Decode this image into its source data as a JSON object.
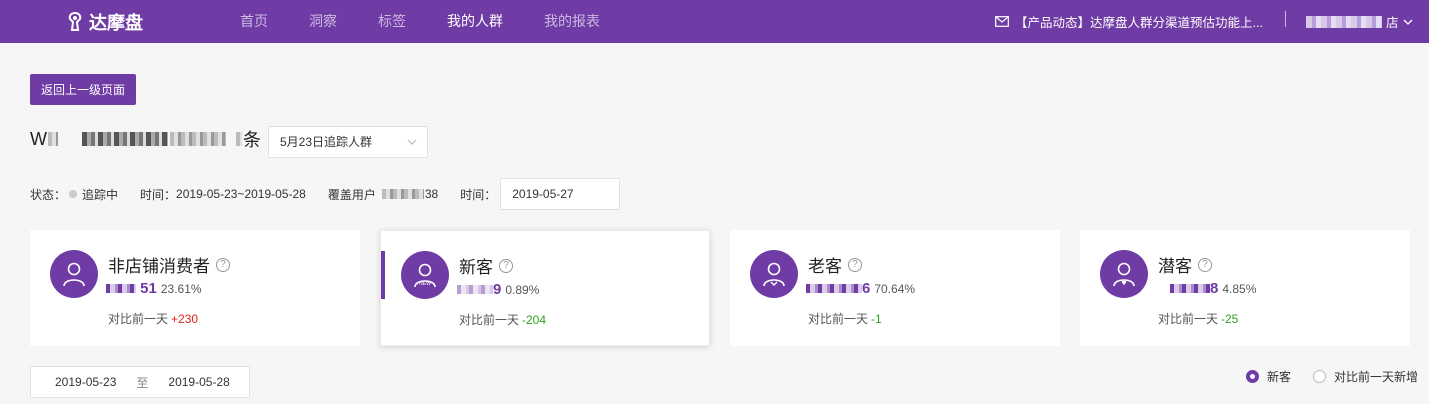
{
  "brand": {
    "name": "达摩盘"
  },
  "nav": [
    {
      "label": "首页",
      "active": false
    },
    {
      "label": "洞察",
      "active": false
    },
    {
      "label": "标签",
      "active": false
    },
    {
      "label": "我的人群",
      "active": true
    },
    {
      "label": "我的报表",
      "active": false
    }
  ],
  "notice": {
    "text": "【产品动态】达摩盘人群分渠道预估功能上..."
  },
  "account": {
    "suffix": "店"
  },
  "back_button": "返回上一级页面",
  "group": {
    "prefix": "W",
    "suffix": "条",
    "select_value": "5月23日追踪人群"
  },
  "meta": {
    "status_label": "状态：",
    "status_value": "追踪中",
    "time_label": "时间：",
    "time_value": "2019-05-23~2019-05-28",
    "coverage_label": "覆盖用户",
    "coverage_tail": "38",
    "date_label": "时间：",
    "date_value": "2019-05-27"
  },
  "cards": [
    {
      "title": "非店铺消费者",
      "icon": "user-icon",
      "count_tail": "51",
      "percent": "23.61%",
      "compare_label": "对比前一天",
      "delta": "+230",
      "trend": "up"
    },
    {
      "title": "新客",
      "icon": "new-user-icon",
      "count_tail": "9",
      "percent": "0.89%",
      "compare_label": "对比前一天",
      "delta": "-204",
      "trend": "down"
    },
    {
      "title": "老客",
      "icon": "loyal-user-icon",
      "count_tail": "6",
      "percent": "70.64%",
      "compare_label": "对比前一天",
      "delta": "-1",
      "trend": "down"
    },
    {
      "title": "潜客",
      "icon": "potential-user-icon",
      "count_tail": "8",
      "percent": "4.85%",
      "compare_label": "对比前一天",
      "delta": "-25",
      "trend": "down"
    }
  ],
  "range": {
    "start": "2019-05-23",
    "to": "至",
    "end": "2019-05-28"
  },
  "radios": [
    {
      "label": "新客",
      "checked": true
    },
    {
      "label": "对比前一天新增",
      "checked": false
    }
  ],
  "colors": {
    "brand": "#6f3ba4",
    "up": "#e0211f",
    "down": "#2ea121"
  }
}
